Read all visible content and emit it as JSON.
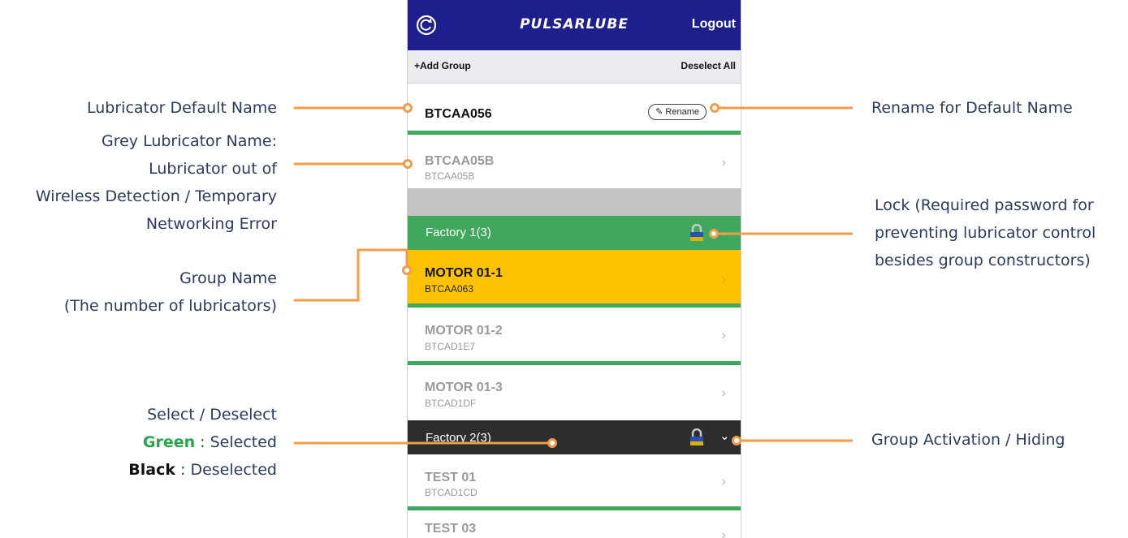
{
  "annotations": {
    "default_name": "Lubricator Default Name",
    "grey_name": [
      "Grey Lubricator Name:",
      "Lubricator out of",
      "Wireless Detection / Temporary",
      "Networking Error"
    ],
    "group_name": [
      "Group Name",
      "(The number of lubricators)"
    ],
    "select": {
      "line1": "Select / Deselect",
      "green_word": "Green",
      "green_rest": " : Selected",
      "black_word": "Black",
      "black_rest": " : Deselected"
    },
    "rename": "Rename for Default Name",
    "lock": [
      "Lock (Required password for",
      "preventing lubricator control",
      "besides group constructors)"
    ],
    "activation": "Group Activation / Hiding"
  },
  "app": {
    "logo": "PULSARLUBE",
    "logout": "Logout",
    "add_group": "+Add Group",
    "deselect_all": "Deselect All",
    "rename_label": "Rename",
    "pencil_icon": "pencil-icon",
    "colors": {
      "header": "#1e1e8c",
      "group_selected": "#3fa85c",
      "group_deselected": "#2d2d2d",
      "row_selected": "#fdc300",
      "offline_text": "#9a9a9a",
      "accent": "#f39b46"
    }
  },
  "default_row": {
    "name": "BTCAA056"
  },
  "grey_row": {
    "name": "BTCAA05B",
    "id": "BTCAA05B"
  },
  "group1": {
    "name": "Factory 1(3)",
    "state": "selected",
    "items": [
      {
        "name": "MOTOR 01-1",
        "id": "BTCAA063",
        "state": "highlighted"
      },
      {
        "name": "MOTOR 01-2",
        "id": "BTCAD1E7",
        "state": "offline"
      },
      {
        "name": "MOTOR 01-3",
        "id": "BTCAD1DF",
        "state": "offline"
      }
    ]
  },
  "group2": {
    "name": "Factory 2(3)",
    "state": "deselected",
    "items": [
      {
        "name": "TEST 01",
        "id": "BTCAD1CD",
        "state": "offline"
      },
      {
        "name": "TEST 03",
        "id": "",
        "state": "offline"
      }
    ]
  }
}
